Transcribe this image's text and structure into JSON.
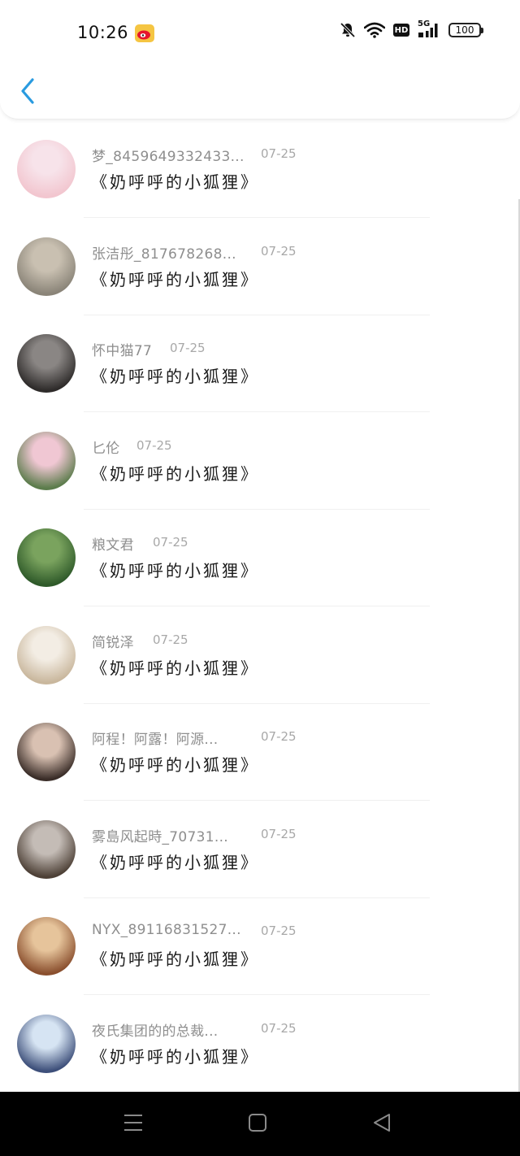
{
  "status_bar": {
    "time": "10:26",
    "network": "5G",
    "hd": "HD",
    "battery": "100"
  },
  "header": {
    "back_icon": "chevron-left-icon"
  },
  "items": [
    {
      "name": "梦_8459649332433...",
      "date": "07-25",
      "message": "《奶呼呼的小狐狸》",
      "avatar_colors": [
        "#f2c6cf",
        "#f7e3ea"
      ]
    },
    {
      "name": "张洁彤_817678268...",
      "date": "07-25",
      "message": "《奶呼呼的小狐狸》",
      "avatar_colors": [
        "#8a8478",
        "#c9c0b1"
      ]
    },
    {
      "name": "怀中猫77",
      "date": "07-25",
      "message": "《奶呼呼的小狐狸》",
      "avatar_colors": [
        "#2e2b2a",
        "#8a8684"
      ]
    },
    {
      "name": "匕伦",
      "date": "07-25",
      "message": "《奶呼呼的小狐狸》",
      "avatar_colors": [
        "#5c7c4c",
        "#f0c7d3"
      ]
    },
    {
      "name": "粮文君",
      "date": "07-25",
      "message": "《奶呼呼的小狐狸》",
      "avatar_colors": [
        "#2f5a2a",
        "#7aa35e"
      ]
    },
    {
      "name": "简锐泽",
      "date": "07-25",
      "message": "《奶呼呼的小狐狸》",
      "avatar_colors": [
        "#c9b79d",
        "#f3ede4"
      ]
    },
    {
      "name": "阿程！阿露！阿源...",
      "date": "07-25",
      "message": "《奶呼呼的小狐狸》",
      "avatar_colors": [
        "#3a2d28",
        "#d9c1b2"
      ]
    },
    {
      "name": "雾島风起時_70731...",
      "date": "07-25",
      "message": "《奶呼呼的小狐狸》",
      "avatar_colors": [
        "#4d4036",
        "#c4bcb6"
      ]
    },
    {
      "name": "NYX_89116831527...",
      "date": "07-25",
      "message": "《奶呼呼的小狐狸》",
      "avatar_colors": [
        "#8a4f2e",
        "#e6c49b"
      ]
    },
    {
      "name": "夜氏集团的的总裁...",
      "date": "07-25",
      "message": "《奶呼呼的小狐狸》",
      "avatar_colors": [
        "#3d4f7a",
        "#d6e4f3"
      ]
    }
  ],
  "nav_bar": {
    "menu_icon": "menu-icon",
    "home_icon": "home-icon",
    "back_icon": "back-triangle-icon"
  }
}
